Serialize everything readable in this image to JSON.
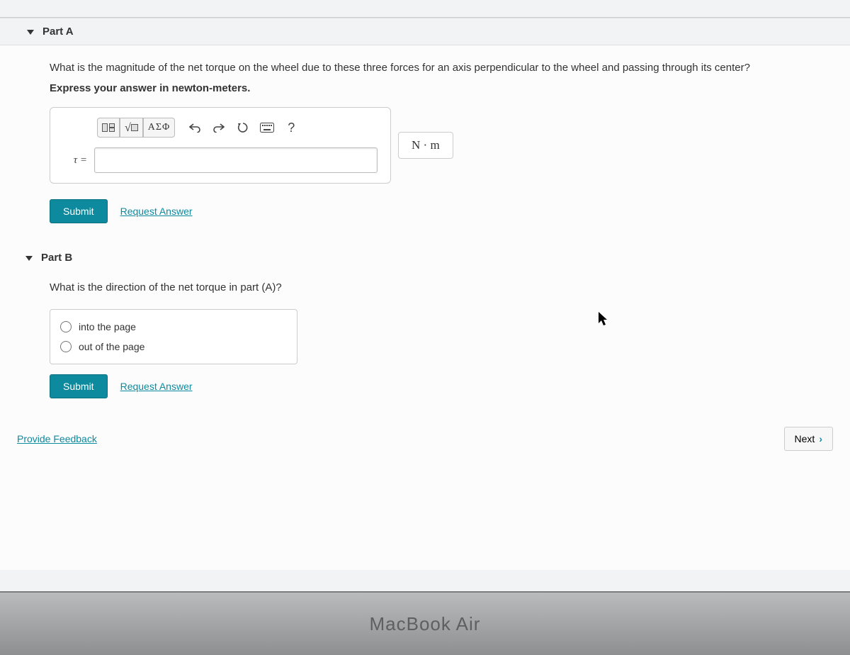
{
  "partA": {
    "title": "Part A",
    "question": "What is the magnitude of the net torque on the wheel due to these three forces for an axis perpendicular to the wheel and passing through its center?",
    "instruction": "Express your answer in newton-meters.",
    "var_label": "τ =",
    "input_value": "",
    "unit_label": "N · m",
    "greek_btn": "ΑΣΦ",
    "help_btn": "?",
    "submit_label": "Submit",
    "request_label": "Request Answer"
  },
  "partB": {
    "title": "Part B",
    "question": "What is the direction of the net torque in part (A)?",
    "options": [
      "into the page",
      "out of the page"
    ],
    "submit_label": "Submit",
    "request_label": "Request Answer"
  },
  "footer": {
    "feedback": "Provide Feedback",
    "next": "Next"
  },
  "device": "MacBook Air"
}
